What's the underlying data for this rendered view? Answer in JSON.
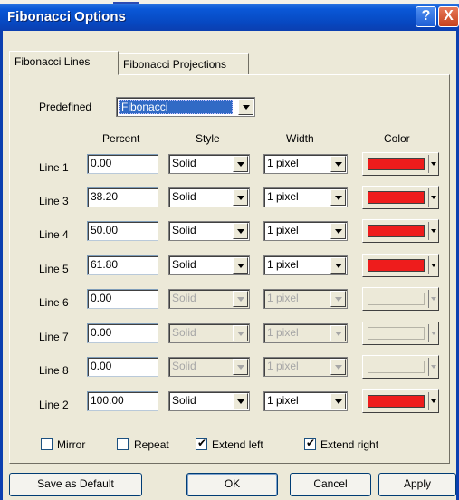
{
  "window": {
    "title": "Fibonacci Options",
    "help_glyph": "?",
    "close_glyph": "X"
  },
  "tabs": [
    {
      "label": "Fibonacci Lines",
      "active": true
    },
    {
      "label": "Fibonacci Projections",
      "active": false
    }
  ],
  "predefined": {
    "label": "Predefined",
    "value": "Fibonacci"
  },
  "columns": {
    "percent": "Percent",
    "style": "Style",
    "width": "Width",
    "color": "Color"
  },
  "lines": [
    {
      "label": "Line 1",
      "percent": "0.00",
      "style": "Solid",
      "width": "1 pixel",
      "color": "#ee1c1c",
      "enabled": true
    },
    {
      "label": "Line 3",
      "percent": "38.20",
      "style": "Solid",
      "width": "1 pixel",
      "color": "#ee1c1c",
      "enabled": true
    },
    {
      "label": "Line 4",
      "percent": "50.00",
      "style": "Solid",
      "width": "1 pixel",
      "color": "#ee1c1c",
      "enabled": true
    },
    {
      "label": "Line 5",
      "percent": "61.80",
      "style": "Solid",
      "width": "1 pixel",
      "color": "#ee1c1c",
      "enabled": true
    },
    {
      "label": "Line 6",
      "percent": "0.00",
      "style": "Solid",
      "width": "1 pixel",
      "color": "#ece9d8",
      "enabled": false
    },
    {
      "label": "Line 7",
      "percent": "0.00",
      "style": "Solid",
      "width": "1 pixel",
      "color": "#ece9d8",
      "enabled": false
    },
    {
      "label": "Line 8",
      "percent": "0.00",
      "style": "Solid",
      "width": "1 pixel",
      "color": "#ece9d8",
      "enabled": false
    },
    {
      "label": "Line 2",
      "percent": "100.00",
      "style": "Solid",
      "width": "1 pixel",
      "color": "#ee1c1c",
      "enabled": true
    }
  ],
  "options": [
    {
      "label": "Mirror",
      "checked": false
    },
    {
      "label": "Repeat",
      "checked": false
    },
    {
      "label": "Extend left",
      "checked": true
    },
    {
      "label": "Extend right",
      "checked": true
    }
  ],
  "buttons": {
    "save_default": "Save as Default",
    "ok": "OK",
    "cancel": "Cancel",
    "apply": "Apply"
  }
}
